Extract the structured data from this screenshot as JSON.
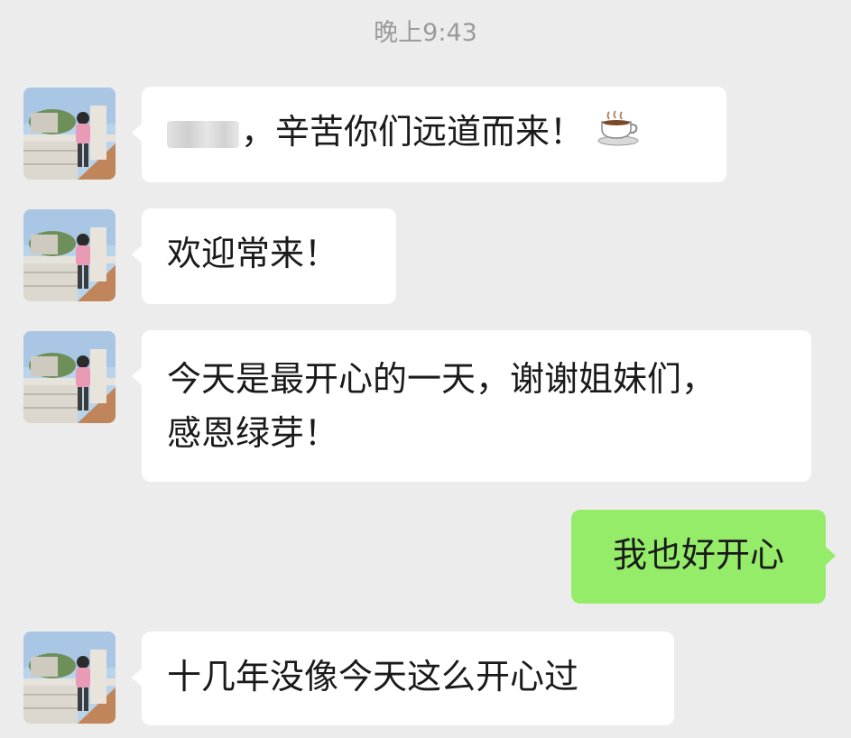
{
  "timestamp": "晚上9:43",
  "messages": [
    {
      "side": "left",
      "pre_punct": "，",
      "text": "辛苦你们远道而来！",
      "emoji": "coffee-cup-icon"
    },
    {
      "side": "left",
      "text": "欢迎常来！"
    },
    {
      "side": "left",
      "line1": "今天是最开心的一天，谢谢姐妹们，",
      "line2": "感恩绿芽！"
    },
    {
      "side": "right",
      "text": "我也好开心"
    },
    {
      "side": "left",
      "text": "十几年没像今天这么开心过"
    }
  ],
  "colors": {
    "background": "#ececec",
    "received_bubble": "#ffffff",
    "sent_bubble": "#95ec69",
    "timestamp_text": "#9a9a9a"
  }
}
